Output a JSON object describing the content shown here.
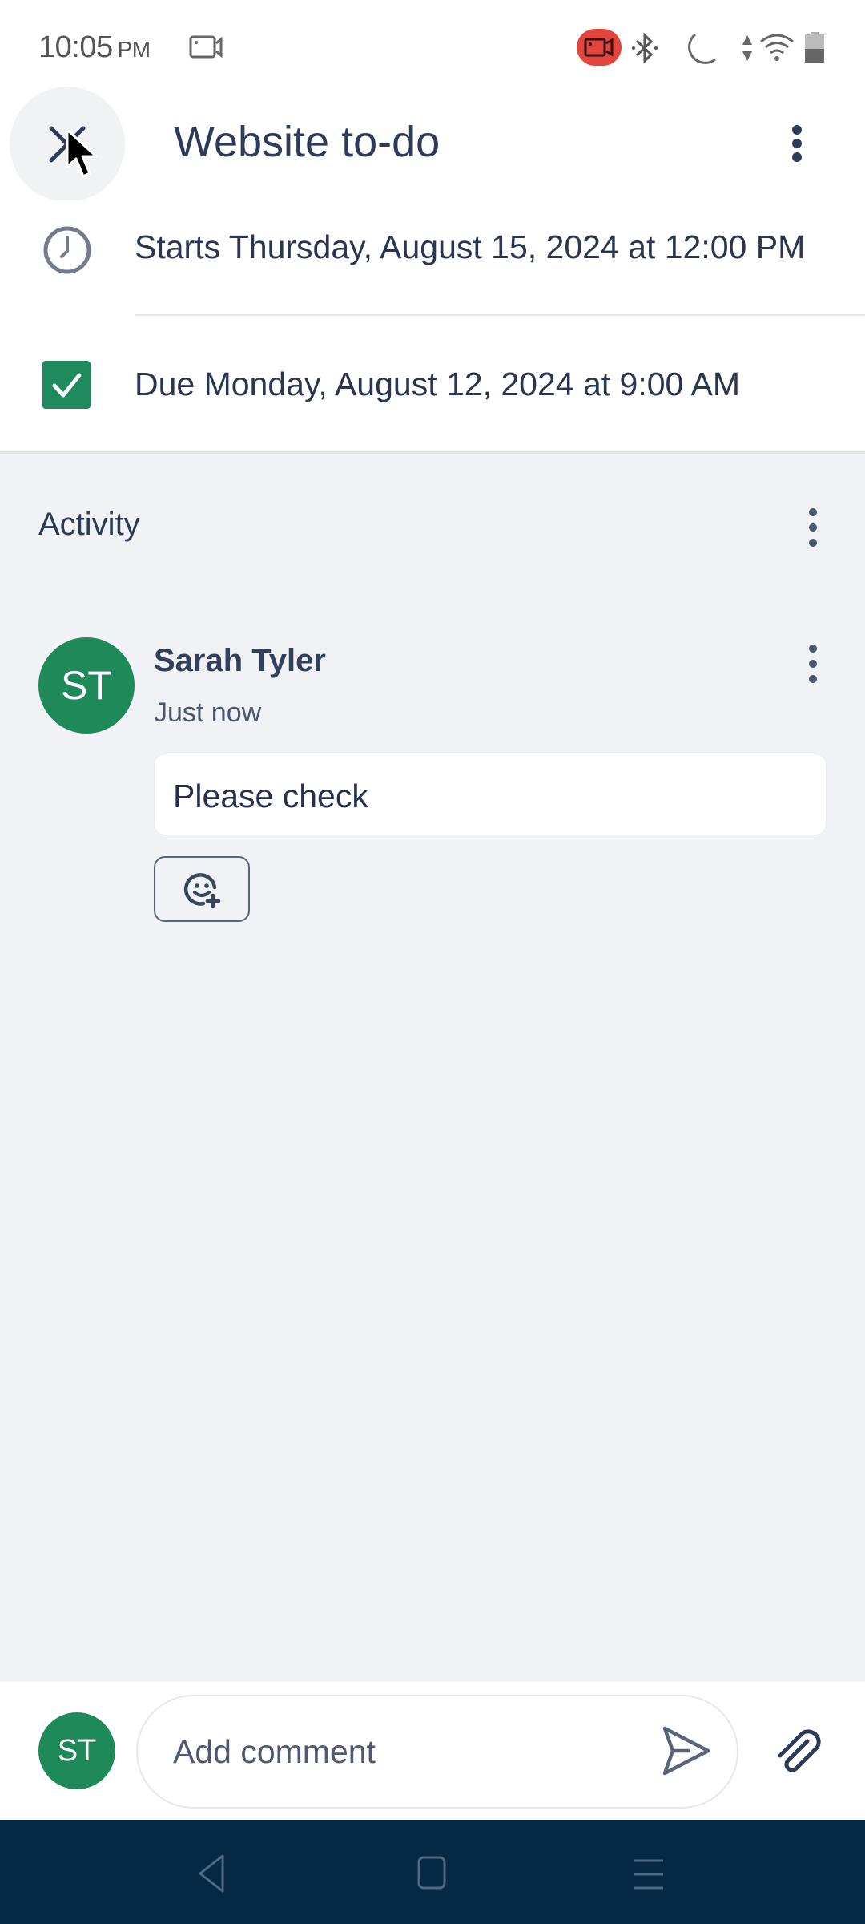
{
  "status_bar": {
    "time": "10:05",
    "ampm": "PM",
    "icons": [
      "screen-record-icon",
      "recording-badge-icon",
      "bluetooth-icon",
      "do-not-disturb-icon",
      "data-arrows-icon",
      "wifi-icon",
      "battery-icon"
    ]
  },
  "header": {
    "title": "Website to-do",
    "close_icon": "close-icon",
    "more_icon": "more-vert-icon"
  },
  "details": {
    "start": "Starts Thursday, August 15, 2024 at 12:00 PM",
    "due": "Due Monday, August 12, 2024 at 9:00 AM",
    "due_checked": true
  },
  "activity": {
    "label": "Activity",
    "comments": [
      {
        "initials": "ST",
        "author": "Sarah Tyler",
        "time": "Just now",
        "text": "Please check"
      }
    ]
  },
  "composer": {
    "initials": "ST",
    "placeholder": "Add comment"
  },
  "colors": {
    "accent_green": "#1e8a5a",
    "text_primary": "#2e3b58",
    "nav_bar": "#052844",
    "record_red": "#e2453c"
  }
}
